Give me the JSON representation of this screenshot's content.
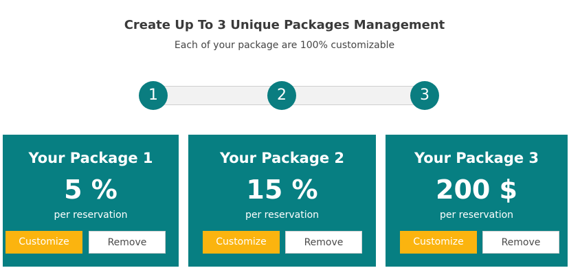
{
  "header": {
    "title": "Create Up To 3 Unique Packages Management",
    "subtitle": "Each of your package are 100% customizable"
  },
  "stepper": {
    "steps": [
      "1",
      "2",
      "3"
    ]
  },
  "packages": [
    {
      "title": "Your Package 1",
      "value": "5 %",
      "subtitle": "per reservation",
      "customize_label": "Customize",
      "remove_label": "Remove"
    },
    {
      "title": "Your Package 2",
      "value": "15 %",
      "subtitle": "per reservation",
      "customize_label": "Customize",
      "remove_label": "Remove"
    },
    {
      "title": "Your Package 3",
      "value": "200 $",
      "subtitle": "per reservation",
      "customize_label": "Customize",
      "remove_label": "Remove"
    }
  ],
  "colors": {
    "teal": "#077f82",
    "step_teal": "#0a7d80",
    "customize_yellow": "#fbb40f",
    "track_gray": "#f2f2f2"
  }
}
